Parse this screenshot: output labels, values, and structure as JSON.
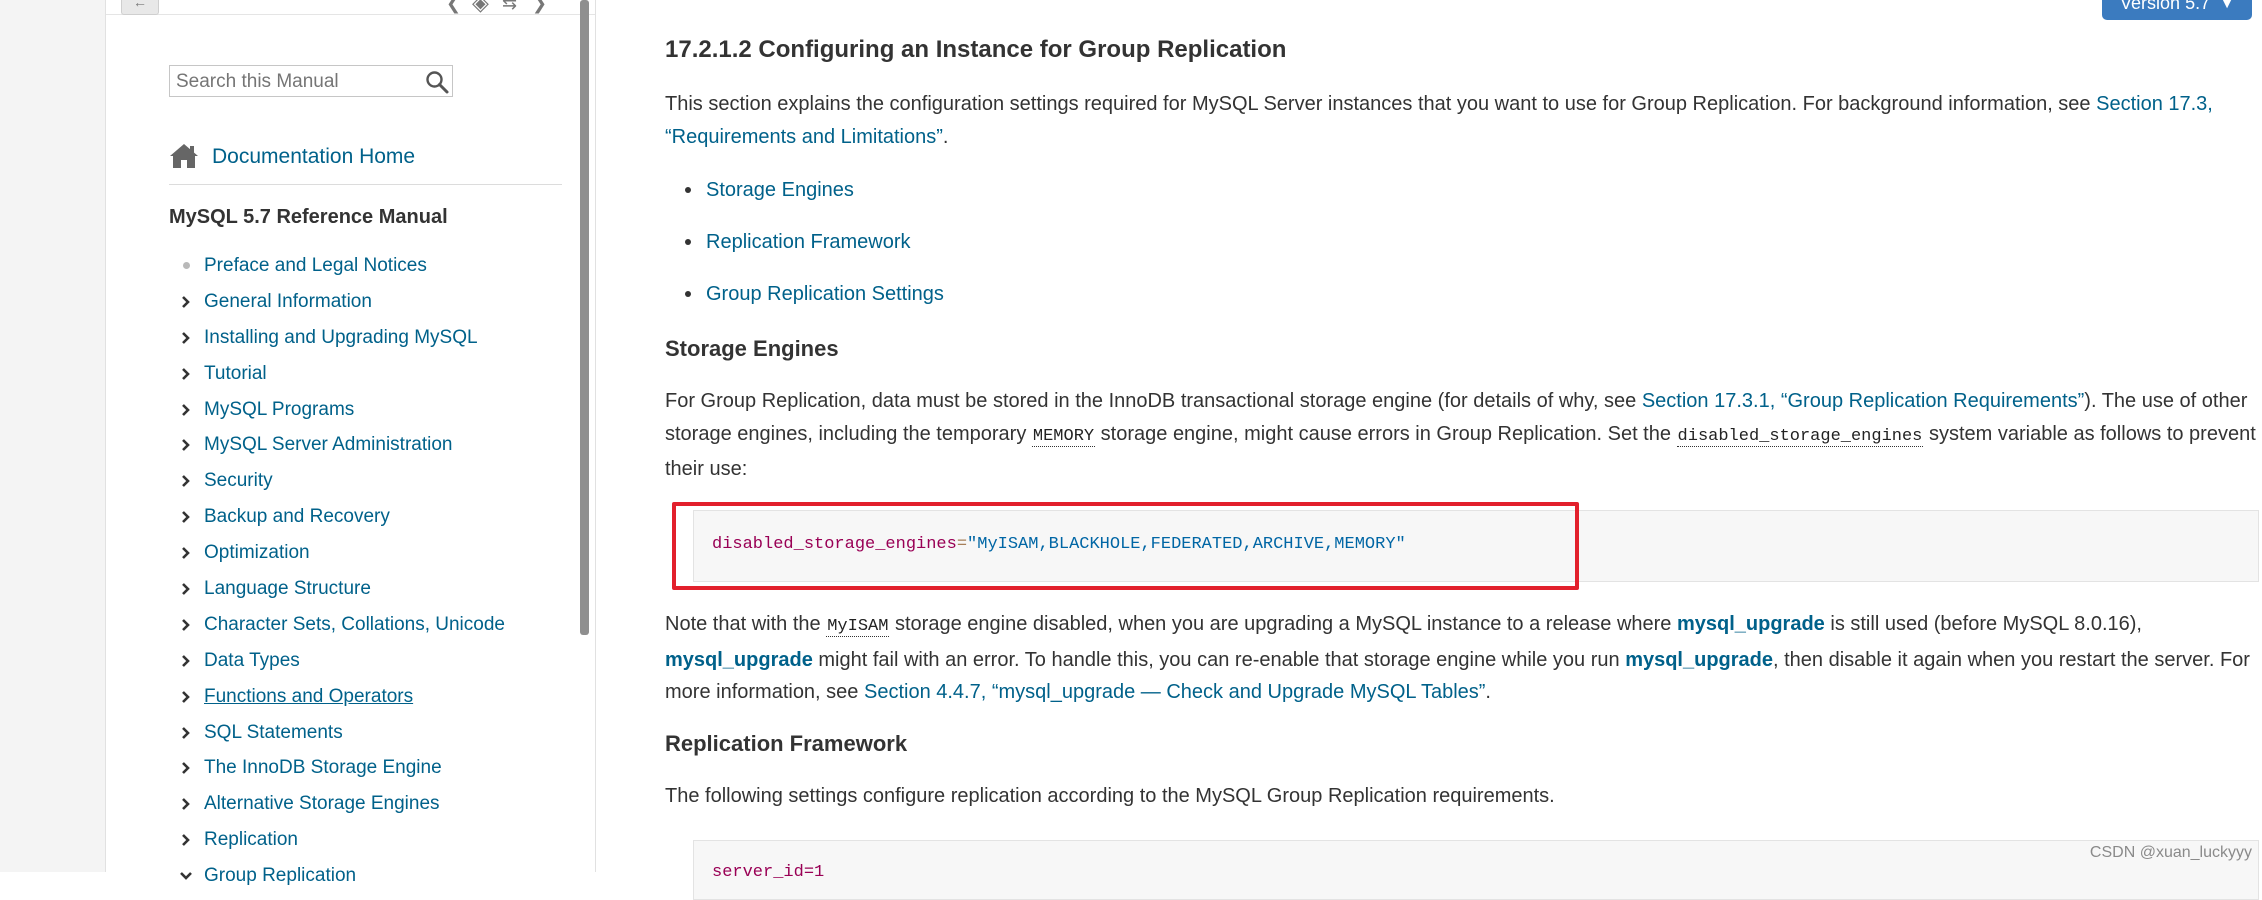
{
  "sidebar": {
    "search_placeholder": "Search this Manual",
    "doc_home": "Documentation Home",
    "manual_title": "MySQL 5.7 Reference Manual",
    "toc": [
      {
        "label": "Preface and Legal Notices",
        "marker": "dot"
      },
      {
        "label": "General Information",
        "marker": "chevron"
      },
      {
        "label": "Installing and Upgrading MySQL",
        "marker": "chevron"
      },
      {
        "label": "Tutorial",
        "marker": "chevron"
      },
      {
        "label": "MySQL Programs",
        "marker": "chevron"
      },
      {
        "label": "MySQL Server Administration",
        "marker": "chevron"
      },
      {
        "label": "Security",
        "marker": "chevron"
      },
      {
        "label": "Backup and Recovery",
        "marker": "chevron"
      },
      {
        "label": "Optimization",
        "marker": "chevron"
      },
      {
        "label": "Language Structure",
        "marker": "chevron"
      },
      {
        "label": "Character Sets, Collations, Unicode",
        "marker": "chevron"
      },
      {
        "label": "Data Types",
        "marker": "chevron"
      },
      {
        "label": "Functions and Operators",
        "marker": "chevron",
        "underlined": true
      },
      {
        "label": "SQL Statements",
        "marker": "chevron"
      },
      {
        "label": "The InnoDB Storage Engine",
        "marker": "chevron"
      },
      {
        "label": "Alternative Storage Engines",
        "marker": "chevron"
      },
      {
        "label": "Replication",
        "marker": "chevron"
      },
      {
        "label": "Group Replication",
        "marker": "chevron-down"
      }
    ]
  },
  "header": {
    "version_label": "Version 5.7"
  },
  "content": {
    "title": "17.2.1.2 Configuring an Instance for Group Replication",
    "intro_text": "This section explains the configuration settings required for MySQL Server instances that you want to use for Group Replication. For background information, see",
    "intro_link": "Section 17.3, “Requirements and Limitations”",
    "intro_end": ".",
    "bullets": [
      "Storage Engines",
      "Replication Framework",
      "Group Replication Settings"
    ],
    "storage_heading": "Storage Engines",
    "storage_p1": "For Group Replication, data must be stored in the InnoDB transactional storage engine (for details of why, see",
    "storage_link": "Section 17.3.1, “Group Replication Requirements”",
    "storage_p2": "). The use of other storage engines, including the temporary",
    "storage_code1": "MEMORY",
    "storage_p3": "storage engine, might cause errors in Group Replication. Set the",
    "storage_code2": "disabled_storage_engines",
    "storage_p4": "system variable as follows to prevent their use:",
    "code_key": "disabled_storage_engines",
    "code_eq": "=",
    "code_value": "\"MyISAM,BLACKHOLE,FEDERATED,ARCHIVE,MEMORY\"",
    "note_p1": "Note that with the",
    "note_code": "MyISAM",
    "note_p2": "storage engine disabled, when you are upgrading a MySQL instance to a release where",
    "note_cmd1": "mysql_upgrade",
    "note_p3": "is still used (before MySQL 8.0.16),",
    "note_cmd2": "mysql_upgrade",
    "note_p4": "might fail with an error. To handle this, you can re-enable that storage engine while you run",
    "note_cmd3": "mysql_upgrade",
    "note_p5": ", then disable it again when you restart the server. For more information, see",
    "note_link": "Section 4.4.7, “mysql_upgrade — Check and Upgrade MySQL Tables”",
    "note_end": ".",
    "repl_heading": "Replication Framework",
    "repl_text": "The following settings configure replication according to the MySQL Group Replication requirements.",
    "code2_partial": "server_id=1"
  },
  "watermark": "CSDN @xuan_luckyyy",
  "colors": {
    "link": "#00618a",
    "highlight_border": "#e2202c",
    "version_button": "#3b7bbf"
  }
}
